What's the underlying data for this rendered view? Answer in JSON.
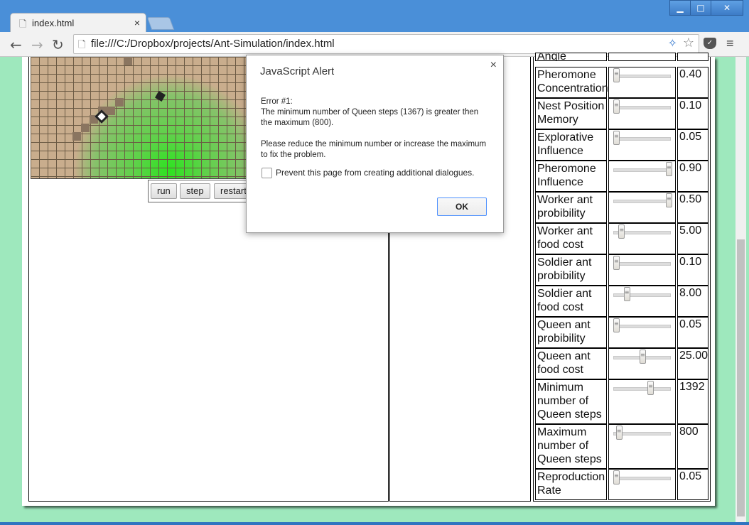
{
  "browser": {
    "tab_title": "index.html",
    "tab_close": "×",
    "url": "file:///C:/Dropbox/projects/Ant-Simulation/index.html",
    "window_controls": {
      "minimize": "▁",
      "maximize": "□",
      "close": "✕"
    }
  },
  "simulation": {
    "buttons": {
      "run": "run",
      "step": "step",
      "restart": "restart"
    }
  },
  "parameters": [
    {
      "label": "Angle",
      "value": "",
      "fraction": 0.5
    },
    {
      "label": "Pheromone Concentration",
      "value": "0.40",
      "fraction": 0.0
    },
    {
      "label": "Nest Position Memory",
      "value": "0.10",
      "fraction": 0.0
    },
    {
      "label": "Explorative Influence",
      "value": "0.05",
      "fraction": 0.0
    },
    {
      "label": "Pheromone Influence",
      "value": "0.90",
      "fraction": 1.0
    },
    {
      "label": "Worker ant probibility",
      "value": "0.50",
      "fraction": 1.0
    },
    {
      "label": "Worker ant food cost",
      "value": "5.00",
      "fraction": 0.1
    },
    {
      "label": "Soldier ant probibility",
      "value": "0.10",
      "fraction": 0.0
    },
    {
      "label": "Soldier ant food cost",
      "value": "8.00",
      "fraction": 0.2
    },
    {
      "label": "Queen ant probibility",
      "value": "0.05",
      "fraction": 0.0
    },
    {
      "label": "Queen ant food cost",
      "value": "25.00",
      "fraction": 0.5
    },
    {
      "label": "Minimum number of Queen steps",
      "value": "1392",
      "fraction": 0.65
    },
    {
      "label": "Maximum number of Queen steps",
      "value": "800",
      "fraction": 0.05
    },
    {
      "label": "Reproduction Rate",
      "value": "0.05",
      "fraction": 0.0
    }
  ],
  "alert": {
    "title": "JavaScript Alert",
    "close": "×",
    "line1": "Error #1:",
    "line2": "The minimum number of Queen steps (1367) is greater then the maximum (800).",
    "line3": "Please reduce the minimum number or increase the maximum to fix the problem.",
    "checkbox_label": "Prevent this page from creating additional dialogues.",
    "ok_label": "OK"
  }
}
